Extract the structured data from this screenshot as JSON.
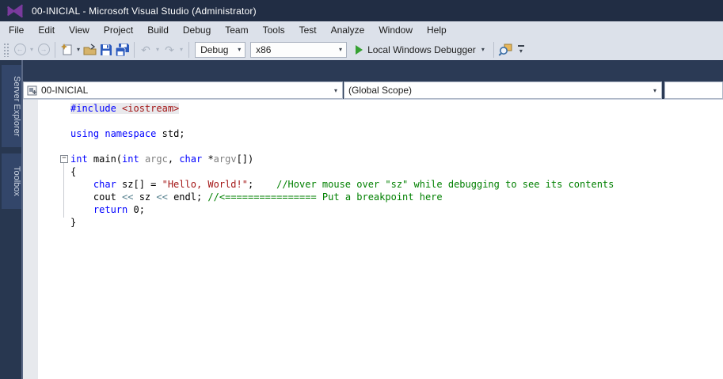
{
  "title_bar": {
    "title": "00-INICIAL - Microsoft Visual Studio (Administrator)"
  },
  "menu": {
    "items": [
      "File",
      "Edit",
      "View",
      "Project",
      "Build",
      "Debug",
      "Team",
      "Tools",
      "Test",
      "Analyze",
      "Window",
      "Help"
    ]
  },
  "toolbar": {
    "solution_config": "Debug",
    "platform": "x86",
    "run_label": "Local Windows Debugger"
  },
  "sidebar": {
    "tabs": [
      "Server Explorer",
      "Toolbox"
    ]
  },
  "navbar": {
    "project": "00-INICIAL",
    "scope": "(Global Scope)"
  },
  "colors": {
    "brand_purple": "#7a3a9d",
    "run_green": "#36a132",
    "titlebar_bg": "#212d44",
    "band_bg": "#2b3a55",
    "chrome_bg": "#dce1ea"
  },
  "editor": {
    "palette": {
      "pp": "#0000ff",
      "kw": "#0000ff",
      "str": "#a31515",
      "com": "#008000",
      "par": "#808080",
      "op": "#56808e",
      "pl": "#000000"
    },
    "lines": [
      {
        "highlight": true,
        "tokens": [
          [
            "pp",
            "#include"
          ],
          [
            "pl",
            " "
          ],
          [
            "str",
            "<iostream>"
          ]
        ]
      },
      {
        "tokens": []
      },
      {
        "tokens": [
          [
            "kw",
            "using"
          ],
          [
            "pl",
            " "
          ],
          [
            "kw",
            "namespace"
          ],
          [
            "pl",
            " std;"
          ]
        ]
      },
      {
        "tokens": []
      },
      {
        "collapse": true,
        "tokens": [
          [
            "kw",
            "int"
          ],
          [
            "pl",
            " main("
          ],
          [
            "kw",
            "int"
          ],
          [
            "par",
            " argc"
          ],
          [
            "pl",
            ", "
          ],
          [
            "kw",
            "char"
          ],
          [
            "pl",
            " *"
          ],
          [
            "par",
            "argv"
          ],
          [
            "pl",
            "[])"
          ]
        ]
      },
      {
        "tokens": [
          [
            "pl",
            "{"
          ]
        ]
      },
      {
        "tokens": [
          [
            "pl",
            "    "
          ],
          [
            "kw",
            "char"
          ],
          [
            "pl",
            " sz[] = "
          ],
          [
            "str",
            "\"Hello, World!\""
          ],
          [
            "pl",
            ";    "
          ],
          [
            "com",
            "//Hover mouse over \"sz\" while debugging to see its contents"
          ]
        ]
      },
      {
        "tokens": [
          [
            "pl",
            "    cout "
          ],
          [
            "op",
            "<<"
          ],
          [
            "pl",
            " sz "
          ],
          [
            "op",
            "<<"
          ],
          [
            "pl",
            " endl; "
          ],
          [
            "com",
            "//<================ Put a breakpoint here"
          ]
        ]
      },
      {
        "tokens": [
          [
            "pl",
            "    "
          ],
          [
            "kw",
            "return"
          ],
          [
            "pl",
            " 0;"
          ]
        ]
      },
      {
        "tokens": [
          [
            "pl",
            "}"
          ]
        ]
      }
    ]
  }
}
